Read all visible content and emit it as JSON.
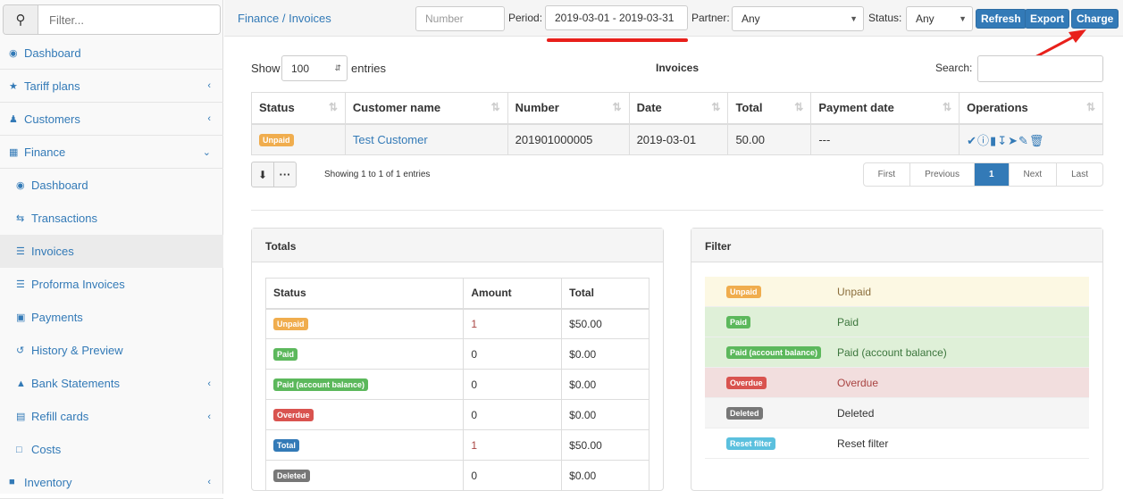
{
  "sidebar": {
    "filter_placeholder": "Filter...",
    "items": [
      {
        "label": "Dashboard",
        "icon": "dashboard-icon"
      },
      {
        "label": "Tariff plans",
        "icon": "star-icon"
      },
      {
        "label": "Customers",
        "icon": "user-icon"
      },
      {
        "label": "Finance",
        "icon": "calculator-icon"
      },
      {
        "label": "Dashboard",
        "icon": "dashboard-icon"
      },
      {
        "label": "Transactions",
        "icon": "exchange-icon"
      },
      {
        "label": "Invoices",
        "icon": "list-icon"
      },
      {
        "label": "Proforma Invoices",
        "icon": "list-alt-icon"
      },
      {
        "label": "Payments",
        "icon": "archive-icon"
      },
      {
        "label": "History & Preview",
        "icon": "history-icon"
      },
      {
        "label": "Bank Statements",
        "icon": "bank-icon"
      },
      {
        "label": "Refill cards",
        "icon": "card-icon"
      },
      {
        "label": "Costs",
        "icon": "note-icon"
      },
      {
        "label": "Inventory",
        "icon": "folder-icon"
      }
    ]
  },
  "topbar": {
    "breadcrumb": "Finance / Invoices",
    "number_placeholder": "Number",
    "period_label": "Period:",
    "period_value": "2019-03-01 - 2019-03-31",
    "partner_label": "Partner:",
    "partner_value": "Any",
    "status_label": "Status:",
    "status_value": "Any",
    "refresh": "Refresh",
    "export": "Export",
    "charge": "Charge"
  },
  "invoices": {
    "show": "Show",
    "entries_value": "100",
    "entries": "entries",
    "title": "Invoices",
    "search": "Search:",
    "columns": [
      "Status",
      "Customer name",
      "Number",
      "Date",
      "Total",
      "Payment date",
      "Operations"
    ],
    "rows": [
      {
        "status": "Unpaid",
        "customer": "Test Customer",
        "number": "201901000005",
        "date": "2019-03-01",
        "total": "50.00",
        "payment_date": "---"
      }
    ],
    "info": "Showing 1 to 1 of 1 entries",
    "pagination": [
      "First",
      "Previous",
      "1",
      "Next",
      "Last"
    ]
  },
  "totals": {
    "title": "Totals",
    "columns": [
      "Status",
      "Amount",
      "Total"
    ],
    "rows": [
      {
        "status": "Unpaid",
        "color": "#f0ad4e",
        "amount": "1",
        "total": "$50.00"
      },
      {
        "status": "Paid",
        "color": "#5cb85c",
        "amount": "0",
        "total": "$0.00"
      },
      {
        "status": "Paid (account balance)",
        "color": "#5cb85c",
        "amount": "0",
        "total": "$0.00"
      },
      {
        "status": "Overdue",
        "color": "#d9534f",
        "amount": "0",
        "total": "$0.00"
      },
      {
        "status": "Total",
        "color": "#337ab7",
        "amount": "1",
        "total": "$50.00"
      },
      {
        "status": "Deleted",
        "color": "#777777",
        "amount": "0",
        "total": "$0.00"
      }
    ]
  },
  "filter": {
    "title": "Filter",
    "rows": [
      {
        "badge": "Unpaid",
        "label": "Unpaid",
        "color": "#f0ad4e",
        "bg": "#fcf8e3",
        "fg": "#8a6d3b"
      },
      {
        "badge": "Paid",
        "label": "Paid",
        "color": "#5cb85c",
        "bg": "#dff0d8",
        "fg": "#3c763d"
      },
      {
        "badge": "Paid (account balance)",
        "label": "Paid (account balance)",
        "color": "#5cb85c",
        "bg": "#dff0d8",
        "fg": "#3c763d"
      },
      {
        "badge": "Overdue",
        "label": "Overdue",
        "color": "#d9534f",
        "bg": "#f2dede",
        "fg": "#a94442"
      },
      {
        "badge": "Deleted",
        "label": "Deleted",
        "color": "#777777",
        "bg": "#f5f5f5",
        "fg": "#333"
      },
      {
        "badge": "Reset filter",
        "label": "Reset filter",
        "color": "#5bc0de",
        "bg": "#fff",
        "fg": "#333"
      }
    ]
  }
}
